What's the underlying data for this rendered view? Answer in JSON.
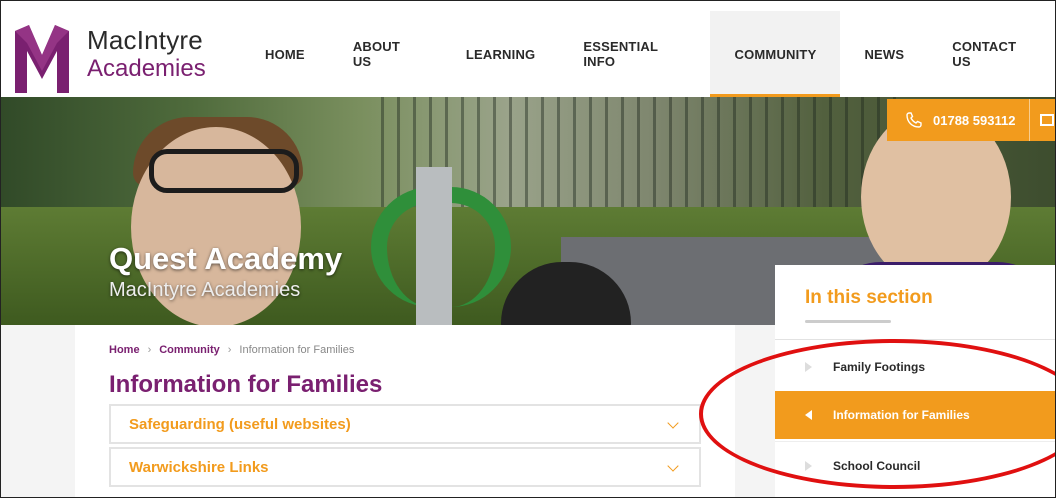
{
  "logo": {
    "title": "MacIntyre",
    "subtitle": "Academies",
    "mark_icon": "macintyre-m-logo"
  },
  "nav": {
    "items": [
      {
        "label": "HOME"
      },
      {
        "label": "ABOUT US"
      },
      {
        "label": "LEARNING"
      },
      {
        "label": "ESSENTIAL INFO"
      },
      {
        "label": "COMMUNITY",
        "active": true
      },
      {
        "label": "NEWS"
      },
      {
        "label": "CONTACT US"
      }
    ]
  },
  "contact": {
    "phone": "01788 593112",
    "phone_icon": "phone-icon",
    "mail_icon": "mail-icon"
  },
  "hero": {
    "title": "Quest Academy",
    "subtitle": "MacIntyre Academies"
  },
  "breadcrumb": {
    "home": "Home",
    "section": "Community",
    "current": "Information for Families",
    "separator": "›"
  },
  "page": {
    "title": "Information for Families",
    "accordions": [
      {
        "label": "Safeguarding (useful websites)"
      },
      {
        "label": "Warwickshire Links"
      }
    ]
  },
  "sidebar": {
    "heading": "In this section",
    "items": [
      {
        "label": "Family Footings",
        "active": false
      },
      {
        "label": "Information for Families",
        "active": true
      },
      {
        "label": "School Council",
        "active": false
      }
    ]
  },
  "colors": {
    "accent": "#f29b1d",
    "brand": "#7a2070",
    "annotation": "#e01010"
  }
}
